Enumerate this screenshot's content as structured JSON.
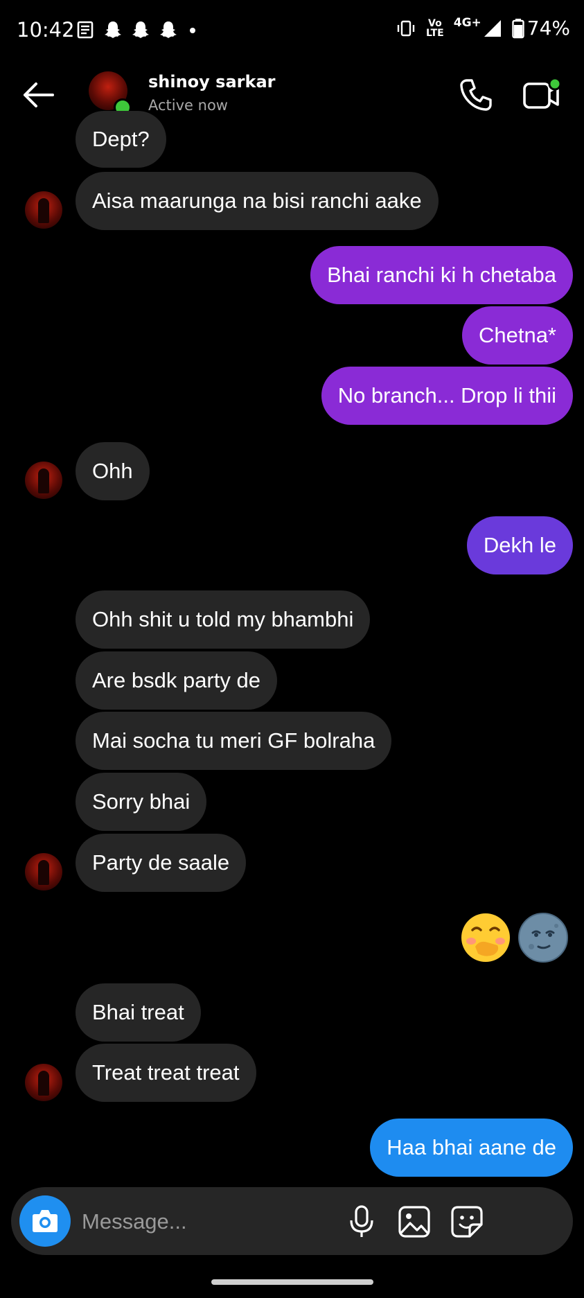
{
  "status_bar": {
    "time": "10:42",
    "left_icons": [
      "news-icon",
      "snapchat-icon",
      "snapchat-icon",
      "snapchat-icon",
      "dot-icon"
    ],
    "volte_top": "Vo",
    "volte_bottom": "LTE",
    "network": "4G+",
    "battery": "74%"
  },
  "header": {
    "contact_name": "shinoy sarkar",
    "status": "Active now",
    "icons": [
      "back-arrow-icon",
      "phone-icon",
      "video-icon"
    ]
  },
  "messages": [
    {
      "side": "in",
      "text": "Dept?"
    },
    {
      "side": "in",
      "text": "Aisa maarunga na bisi ranchi aake"
    },
    {
      "side": "out",
      "text": "Bhai ranchi ki h chetaba"
    },
    {
      "side": "out",
      "text": "Chetna*"
    },
    {
      "side": "out",
      "text": "No branch... Drop li thii"
    },
    {
      "side": "in",
      "text": "Ohh"
    },
    {
      "side": "out",
      "text": "Dekh le"
    },
    {
      "side": "in",
      "text": "Ohh shit u told my bhambhi"
    },
    {
      "side": "in",
      "text": "Are bsdk party de"
    },
    {
      "side": "in",
      "text": "Mai socha tu meri GF bolraha"
    },
    {
      "side": "in",
      "text": "Sorry bhai"
    },
    {
      "side": "in",
      "text": "Party de saale"
    },
    {
      "side": "out",
      "emoji": [
        "hand-over-mouth-emoji",
        "moon-face-emoji"
      ]
    },
    {
      "side": "in",
      "text": "Bhai treat"
    },
    {
      "side": "in",
      "text": "Treat treat treat"
    },
    {
      "side": "out",
      "text": "Haa bhai aane de"
    }
  ],
  "composer": {
    "placeholder": "Message...",
    "icons": [
      "camera-icon",
      "microphone-icon",
      "gallery-icon",
      "sticker-icon"
    ]
  },
  "colors": {
    "background": "#000000",
    "incoming_bubble": "#262626",
    "outgoing_purple": "#8A2BD6",
    "outgoing_violet": "#6A3ADB",
    "outgoing_blue": "#1E8CF0",
    "online_dot": "#3EC83A"
  }
}
